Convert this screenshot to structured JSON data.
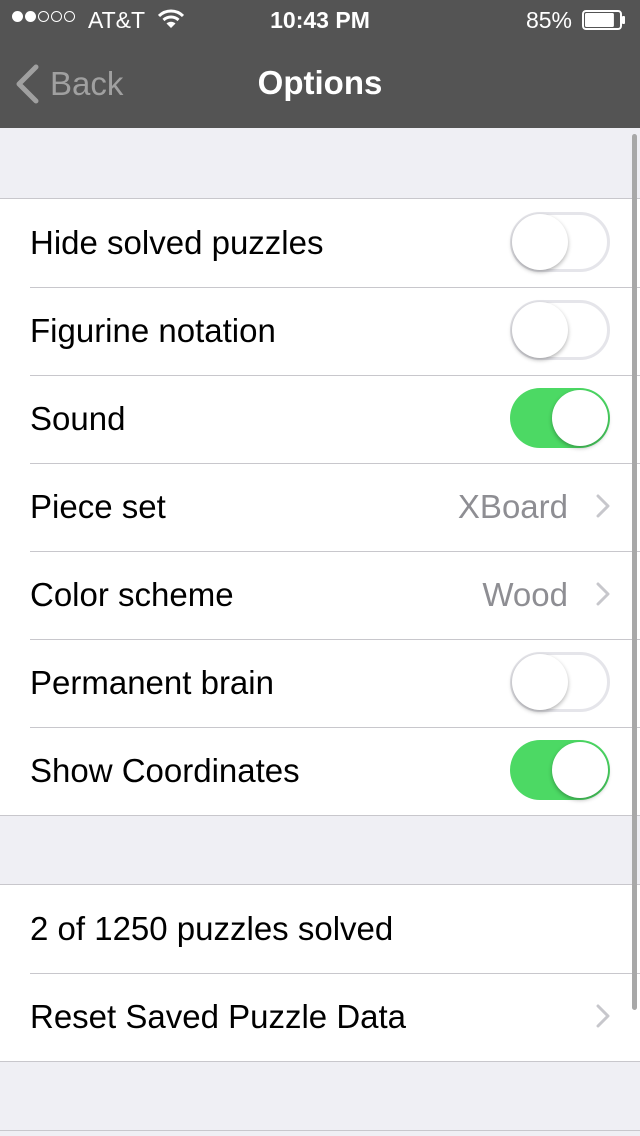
{
  "status_bar": {
    "signal_dots": [
      true,
      true,
      false,
      false,
      false
    ],
    "carrier": "AT&T",
    "time": "10:43 PM",
    "battery_percent": "85%",
    "battery_level": 0.85
  },
  "nav": {
    "back_label": "Back",
    "title": "Options"
  },
  "options": [
    {
      "label": "Hide solved puzzles",
      "control": "toggle",
      "on": false
    },
    {
      "label": "Figurine notation",
      "control": "toggle",
      "on": false
    },
    {
      "label": "Sound",
      "control": "toggle",
      "on": true
    },
    {
      "label": "Piece set",
      "control": "disclosure",
      "value": "XBoard"
    },
    {
      "label": "Color scheme",
      "control": "disclosure",
      "value": "Wood"
    },
    {
      "label": "Permanent brain",
      "control": "toggle",
      "on": false
    },
    {
      "label": "Show Coordinates",
      "control": "toggle",
      "on": true
    }
  ],
  "puzzles": {
    "solved_summary": "2 of 1250 puzzles solved",
    "reset_label": "Reset Saved Puzzle Data"
  },
  "colors": {
    "nav_background": "#545454",
    "toggle_on": "#4cd964",
    "grouped_background": "#efeff4"
  }
}
